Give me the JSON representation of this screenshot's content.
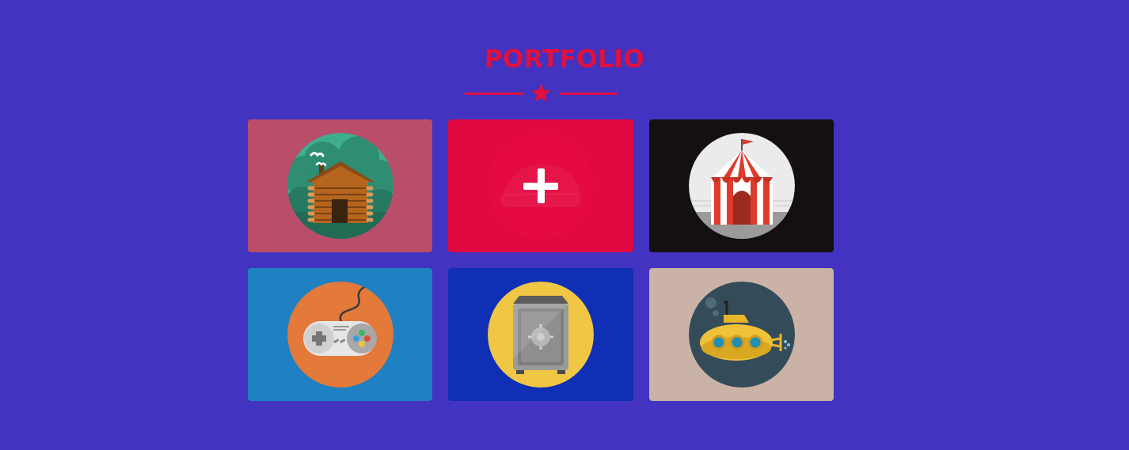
{
  "section": {
    "title": "PORTFOLIO",
    "accent_color": "#e0103f",
    "divider_icon": "star-icon"
  },
  "portfolio_items": [
    {
      "icon": "log-cabin-icon",
      "background": "#b94d6a",
      "hovered": false
    },
    {
      "icon": "cake-icon",
      "background": "#cc1148",
      "hovered": true,
      "overlay_icon": "plus-icon"
    },
    {
      "icon": "circus-tent-icon",
      "background": "#141011",
      "hovered": false
    },
    {
      "icon": "game-controller-icon",
      "background": "#1f80c2",
      "hovered": false
    },
    {
      "icon": "safe-icon",
      "background": "#0f2fb5",
      "hovered": false
    },
    {
      "icon": "submarine-icon",
      "background": "#cbb2a6",
      "hovered": false
    }
  ],
  "page_background": "#4233c0"
}
